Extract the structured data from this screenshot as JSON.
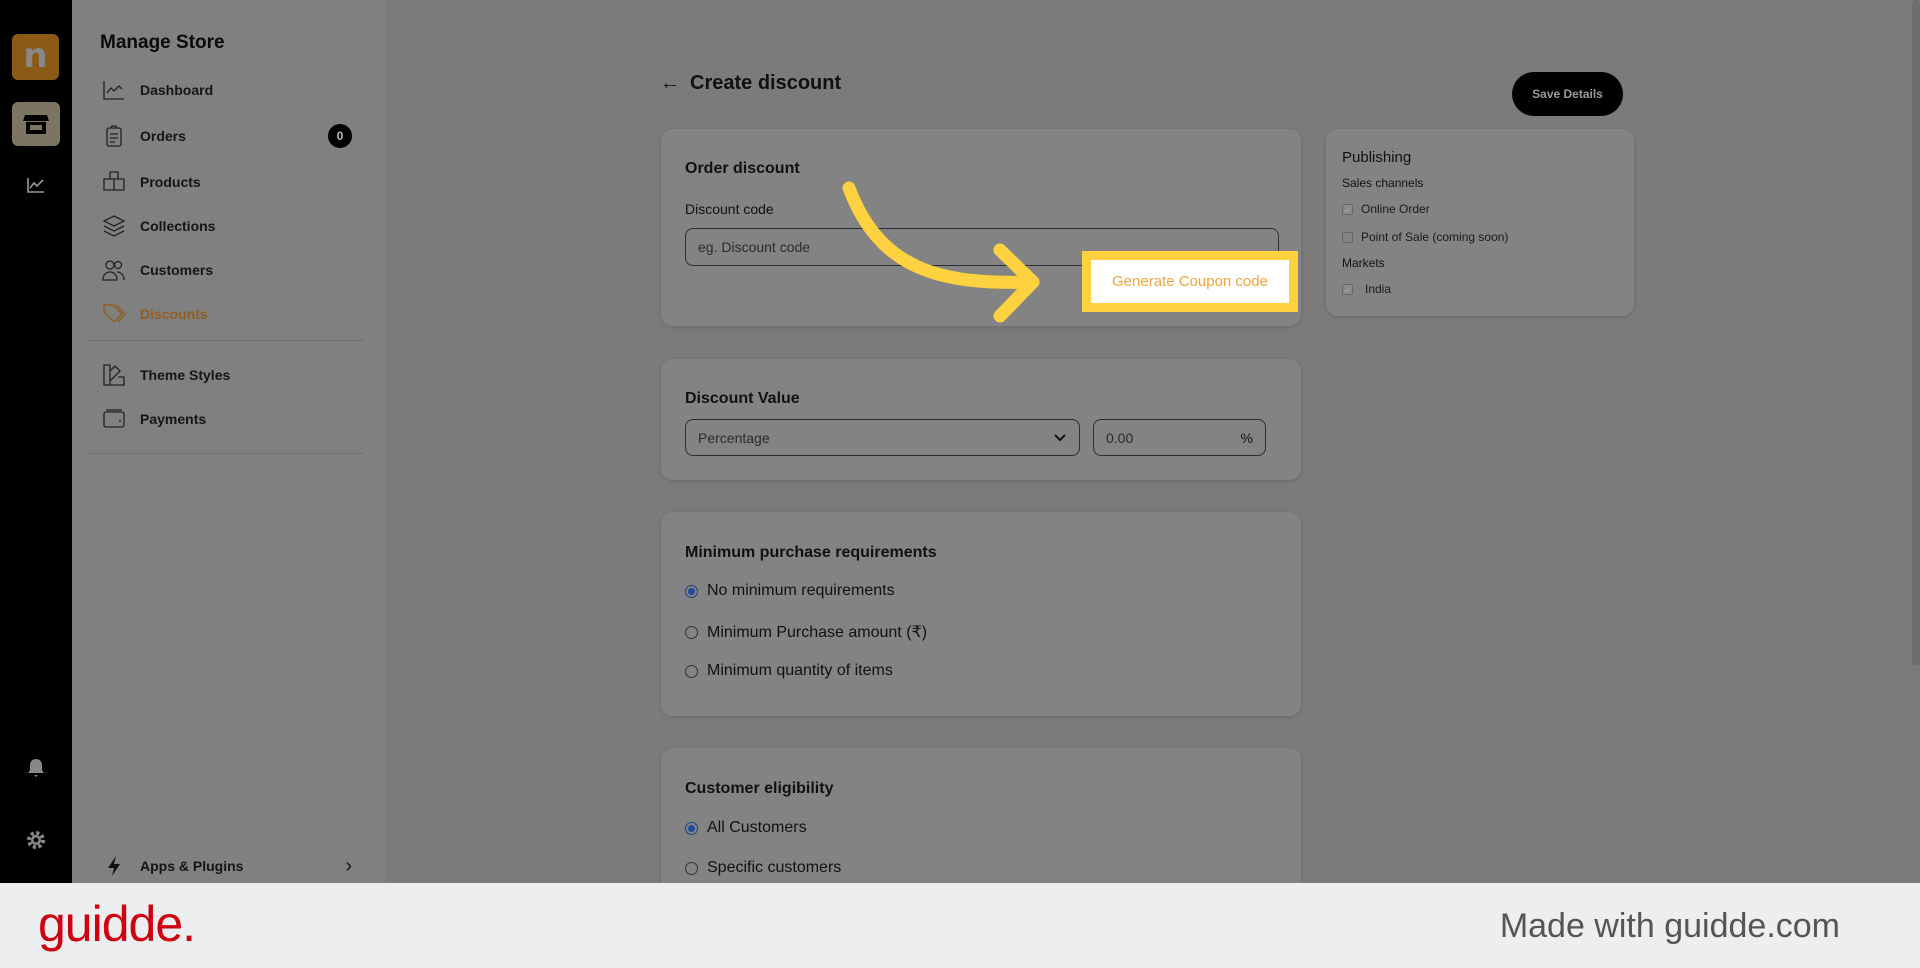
{
  "rail": {
    "logo_letter": "n",
    "icons": [
      "store-icon",
      "chart-icon",
      "bell-icon",
      "gear-icon"
    ]
  },
  "sidebar": {
    "title": "Manage Store",
    "items": [
      {
        "label": "Dashboard",
        "icon": "chart-line-icon"
      },
      {
        "label": "Orders",
        "icon": "clipboard-icon",
        "badge": "0"
      },
      {
        "label": "Products",
        "icon": "boxes-icon"
      },
      {
        "label": "Collections",
        "icon": "layers-icon"
      },
      {
        "label": "Customers",
        "icon": "users-icon"
      },
      {
        "label": "Discounts",
        "icon": "tag-icon",
        "active": true
      },
      {
        "label": "Theme Styles",
        "icon": "palette-icon"
      },
      {
        "label": "Payments",
        "icon": "wallet-icon"
      }
    ],
    "apps": "Apps & Plugins"
  },
  "header": {
    "title": "Create discount",
    "save": "Save Details"
  },
  "order_discount": {
    "title": "Order discount",
    "label": "Discount code",
    "placeholder": "eg. Discount code",
    "generate": "Generate Coupon code"
  },
  "discount_value": {
    "title": "Discount Value",
    "type": "Percentage",
    "value": "0.00",
    "unit": "%"
  },
  "min_purchase": {
    "title": "Minimum purchase requirements",
    "options": [
      "No minimum requirements",
      "Minimum Purchase amount (₹)",
      "Minimum quantity of items"
    ],
    "selected": 0
  },
  "eligibility": {
    "title": "Customer eligibility",
    "options": [
      "All Customers",
      "Specific customers"
    ],
    "selected": 0
  },
  "publishing": {
    "title": "Publishing",
    "channels_label": "Sales channels",
    "channels": [
      {
        "label": "Online Order",
        "checked": true
      },
      {
        "label": "Point of Sale (coming soon)",
        "checked": false
      }
    ],
    "markets_label": "Markets",
    "markets": [
      {
        "label": "India",
        "checked": true
      }
    ]
  },
  "footer": {
    "brand": "guidde.",
    "made": "Made with guidde.com"
  },
  "colors": {
    "accent": "#8f5f22",
    "highlight": "#fdd13f",
    "brand": "#d00010"
  }
}
